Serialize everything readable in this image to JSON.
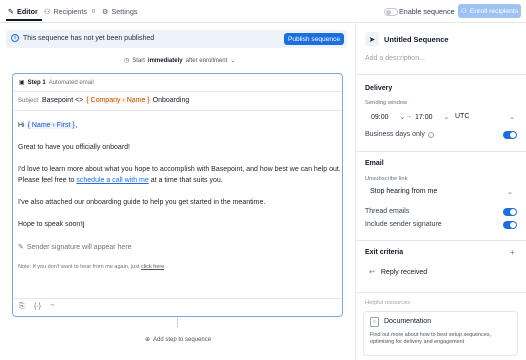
{
  "tabs": [
    {
      "label": "Editor",
      "icon": "pencil-icon",
      "active": true
    },
    {
      "label": "Recipients",
      "icon": "users-icon",
      "count": "0"
    },
    {
      "label": "Settings",
      "icon": "gear-icon"
    }
  ],
  "header": {
    "enable_sequence_label": "Enable sequence",
    "enroll_button": "Enroll recipients"
  },
  "banner": {
    "text": "This sequence has not yet been published",
    "publish_button": "Publish sequence"
  },
  "start": {
    "prefix": "Start",
    "timing": "immediately",
    "suffix": "after enrollment"
  },
  "step": {
    "label": "Step 1",
    "type": "Automated email",
    "subject_label": "Subject",
    "subject_text": "Basepoint <>",
    "subject_token_1": "Company",
    "subject_token_2": "Name",
    "subject_suffix": "Onboarding",
    "greeting": "Hi",
    "greeting_token_1": "Name",
    "greeting_token_2": "First",
    "line1": "Great to have you officially onboard!",
    "line2a": "I'd love to learn more about what you hope to accomplish with Basepoint, and how best we can help out.",
    "line2b_pre": "Please feel free to",
    "line2b_link": "schedule a call with me",
    "line2b_post": "at a time that suits you.",
    "line3": "I've also attached our onboarding guide to help you get started in the meantime.",
    "line4": "Hope to speak soon!",
    "signature": "Sender signature will appear here",
    "note_pre": "Note: If you don't want to hear from me again, just",
    "note_link": "click here",
    "note_post": "."
  },
  "add_step": "Add step to sequence",
  "sidebar": {
    "sequence_title": "Untitled Sequence",
    "description_placeholder": "Add a description...",
    "delivery_title": "Delivery",
    "sending_window_label": "Sending window",
    "window_start": "09:00",
    "window_end": "17:00",
    "timezone": "UTC",
    "business_days_label": "Business days only",
    "email_title": "Email",
    "unsubscribe_label": "Unsubscribe link",
    "unsubscribe_value": "Stop hearing from me",
    "thread_emails_label": "Thread emails",
    "include_signature_label": "Include sender signature",
    "exit_criteria_title": "Exit criteria",
    "exit_item": "Reply received",
    "helpful_resources_label": "Helpful resources",
    "doc_title": "Documentation",
    "doc_text_1": "Find out more about how to best setup sequences,",
    "doc_text_2": "optimising for delivery and engagement"
  },
  "colors": {
    "accent": "#1d6fe0",
    "banner_bg": "#eef2f9",
    "token_company": "#b45309"
  }
}
